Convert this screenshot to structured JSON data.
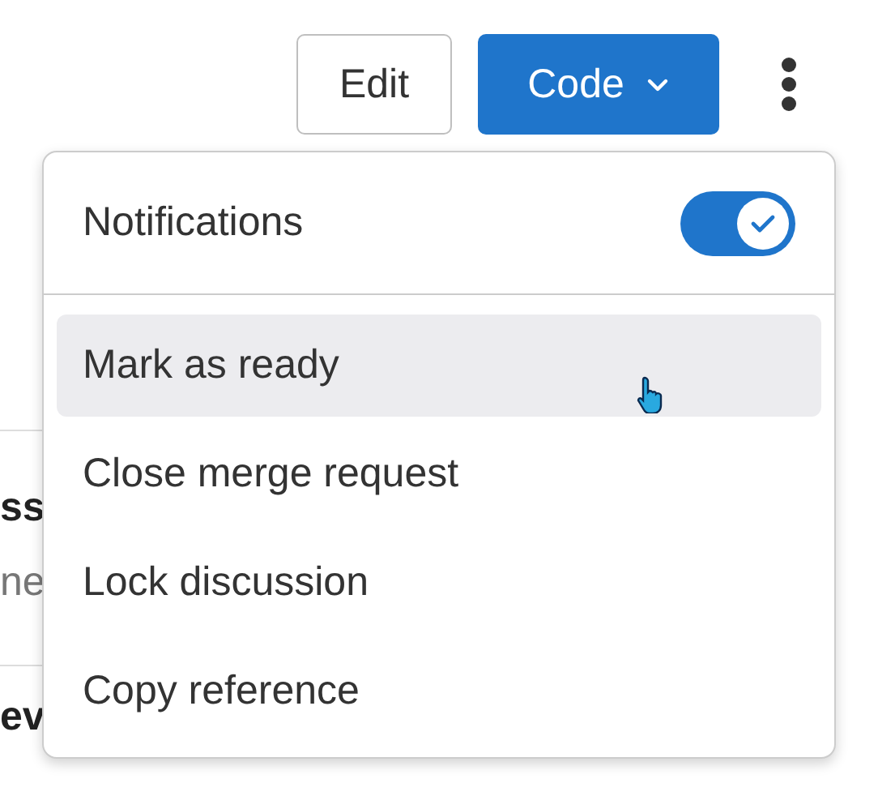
{
  "toolbar": {
    "edit_button": "Edit",
    "code_button": "Code"
  },
  "background_rows": [
    {
      "text": "ss",
      "kind": "title"
    },
    {
      "text": "ne",
      "kind": "subtitle"
    },
    {
      "text": "ev",
      "kind": "title"
    }
  ],
  "menu": {
    "notifications": {
      "label": "Notifications",
      "on": true
    },
    "items": [
      {
        "label": "Mark as ready",
        "selected": true
      },
      {
        "label": "Close merge request",
        "selected": false
      },
      {
        "label": "Lock discussion",
        "selected": false
      },
      {
        "label": "Copy reference",
        "selected": false
      }
    ]
  }
}
